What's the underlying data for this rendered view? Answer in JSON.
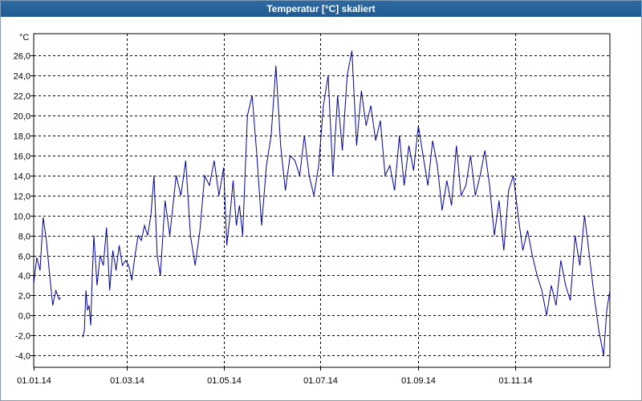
{
  "window": {
    "title": "Temperatur [°C] skaliert"
  },
  "chart_data": {
    "type": "line",
    "title": "Temperatur [°C] skaliert",
    "ylabel": "°C",
    "xlabel": "",
    "ylim": [
      -5.2,
      28.2
    ],
    "xlim": [
      "2014-01-01",
      "2014-12-31"
    ],
    "grid": true,
    "line_color": "#00009c",
    "y_ticks": [
      "26,0",
      "24,0",
      "22,0",
      "20,0",
      "18,0",
      "16,0",
      "14,0",
      "12,0",
      "10,0",
      "8,0",
      "6,0",
      "4,0",
      "2,0",
      "0,0",
      "-2,0",
      "-4,0"
    ],
    "y_tick_values": [
      26,
      24,
      22,
      20,
      18,
      16,
      14,
      12,
      10,
      8,
      6,
      4,
      2,
      0,
      -2,
      -4
    ],
    "x_ticks": [
      "01.01.14",
      "01.03.14",
      "01.05.14",
      "01.07.14",
      "01.09.14",
      "01.11.14"
    ],
    "x_tick_dates": [
      "2014-01-01",
      "2014-03-01",
      "2014-05-01",
      "2014-07-01",
      "2014-09-01",
      "2014-11-01"
    ],
    "series": [
      {
        "x": [
          "2014-01-01",
          "2014-01-03",
          "2014-01-05",
          "2014-01-07",
          "2014-01-09",
          "2014-01-11",
          "2014-01-13",
          "2014-01-15",
          "2014-01-17",
          "2014-01-18"
        ],
        "values": [
          3.2,
          5.8,
          4.5,
          9.8,
          7.5,
          4.2,
          1.0,
          2.5,
          1.6,
          1.8
        ]
      },
      {
        "x": [
          "2014-02-01",
          "2014-02-02",
          "2014-02-03",
          "2014-02-04",
          "2014-02-05",
          "2014-02-06",
          "2014-02-07",
          "2014-02-08",
          "2014-02-10",
          "2014-02-12",
          "2014-02-14",
          "2014-02-16",
          "2014-02-18",
          "2014-02-20",
          "2014-02-22",
          "2014-02-24",
          "2014-02-26",
          "2014-02-28",
          "2014-03-02",
          "2014-03-04",
          "2014-03-06",
          "2014-03-08",
          "2014-03-10",
          "2014-03-12",
          "2014-03-14",
          "2014-03-16",
          "2014-03-18",
          "2014-03-20",
          "2014-03-22",
          "2014-03-25",
          "2014-03-28",
          "2014-04-01",
          "2014-04-04",
          "2014-04-07",
          "2014-04-10",
          "2014-04-13",
          "2014-04-16",
          "2014-04-19",
          "2014-04-22",
          "2014-04-25",
          "2014-04-28",
          "2014-05-01",
          "2014-05-03",
          "2014-05-05",
          "2014-05-07",
          "2014-05-09",
          "2014-05-11",
          "2014-05-13",
          "2014-05-16",
          "2014-05-19",
          "2014-05-22",
          "2014-05-25",
          "2014-05-28",
          "2014-05-31",
          "2014-06-03",
          "2014-06-06",
          "2014-06-09",
          "2014-06-12",
          "2014-06-15",
          "2014-06-18",
          "2014-06-21",
          "2014-06-24",
          "2014-06-27",
          "2014-06-30",
          "2014-07-03",
          "2014-07-06",
          "2014-07-09",
          "2014-07-12",
          "2014-07-15",
          "2014-07-18",
          "2014-07-21",
          "2014-07-24",
          "2014-07-27",
          "2014-07-30",
          "2014-08-02",
          "2014-08-05",
          "2014-08-08",
          "2014-08-11",
          "2014-08-14",
          "2014-08-17",
          "2014-08-20",
          "2014-08-23",
          "2014-08-26",
          "2014-08-29",
          "2014-09-01",
          "2014-09-04",
          "2014-09-07",
          "2014-09-10",
          "2014-09-13",
          "2014-09-16",
          "2014-09-19",
          "2014-09-22",
          "2014-09-25",
          "2014-09-28",
          "2014-10-01",
          "2014-10-04",
          "2014-10-07",
          "2014-10-10",
          "2014-10-13",
          "2014-10-16",
          "2014-10-19",
          "2014-10-22",
          "2014-10-25",
          "2014-10-28",
          "2014-10-31",
          "2014-11-03",
          "2014-11-06",
          "2014-11-09",
          "2014-11-12",
          "2014-11-15",
          "2014-11-18",
          "2014-11-21",
          "2014-11-24",
          "2014-11-27",
          "2014-11-30",
          "2014-12-03",
          "2014-12-06",
          "2014-12-09",
          "2014-12-12",
          "2014-12-15",
          "2014-12-18",
          "2014-12-21",
          "2014-12-24",
          "2014-12-27",
          "2014-12-29",
          "2014-12-31"
        ],
        "values": [
          -2.2,
          -1.5,
          2.5,
          0.5,
          1.0,
          -1.0,
          4.0,
          8.0,
          3.0,
          6.0,
          5.0,
          8.8,
          2.5,
          6.5,
          4.5,
          7.0,
          5.0,
          5.5,
          5.0,
          3.5,
          6.0,
          8.0,
          7.5,
          9.0,
          8.0,
          10.0,
          14.0,
          6.0,
          4.0,
          11.5,
          8.0,
          14.0,
          12.0,
          15.5,
          8.0,
          5.0,
          8.5,
          14.0,
          13.0,
          15.5,
          12.0,
          14.8,
          7.0,
          10.0,
          13.5,
          9.0,
          11.0,
          8.0,
          20.0,
          22.0,
          16.0,
          9.0,
          15.0,
          18.0,
          25.0,
          17.0,
          12.5,
          16.0,
          15.5,
          14.0,
          18.0,
          14.0,
          12.0,
          15.0,
          21.0,
          24.0,
          14.0,
          22.0,
          16.5,
          24.0,
          26.5,
          17.0,
          22.5,
          19.0,
          21.0,
          17.5,
          19.5,
          14.0,
          15.0,
          12.5,
          18.0,
          13.0,
          17.0,
          14.5,
          19.0,
          16.0,
          13.0,
          17.5,
          15.0,
          10.5,
          13.5,
          11.0,
          17.0,
          12.0,
          13.0,
          16.0,
          12.0,
          14.0,
          16.5,
          13.0,
          8.0,
          11.5,
          6.5,
          12.5,
          14.0,
          10.0,
          6.5,
          8.5,
          6.0,
          4.0,
          2.5,
          0.0,
          3.0,
          1.0,
          5.5,
          3.0,
          1.5,
          8.0,
          5.0,
          10.0,
          6.0,
          2.0,
          -1.5,
          -4.0,
          0.5,
          2.5
        ]
      }
    ]
  }
}
